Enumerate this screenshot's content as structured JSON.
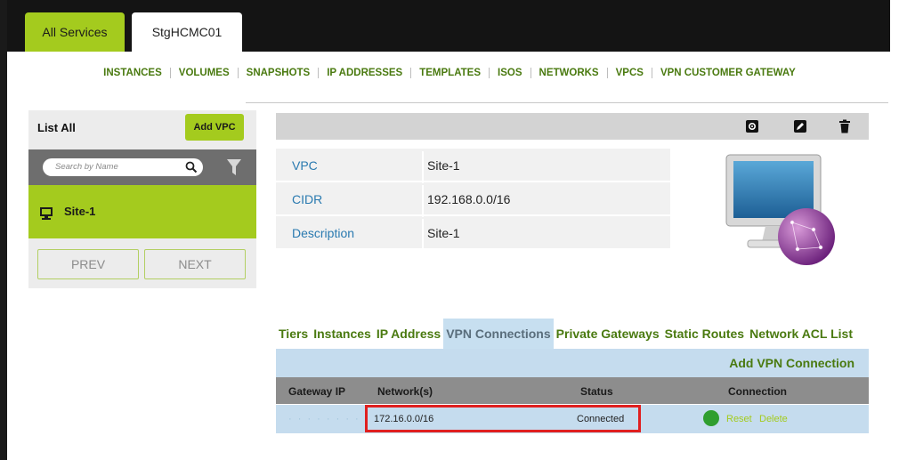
{
  "top_tabs": [
    {
      "label": "All Services"
    },
    {
      "label": "StgHCMC01"
    }
  ],
  "subnav": [
    "INSTANCES",
    "VOLUMES",
    "SNAPSHOTS",
    "IP ADDRESSES",
    "TEMPLATES",
    "ISOS",
    "NETWORKS",
    "VPCS",
    "VPN CUSTOMER GATEWAY"
  ],
  "left_panel": {
    "list_all": "List All",
    "add_vpc": "Add VPC",
    "search_placeholder": "Search by Name",
    "item": "Site-1",
    "prev": "PREV",
    "next": "NEXT"
  },
  "details": [
    {
      "key": "VPC",
      "value": "Site-1"
    },
    {
      "key": "CIDR",
      "value": "192.168.0.0/16"
    },
    {
      "key": "Description",
      "value": "Site-1"
    }
  ],
  "vpn_tabs": [
    "Tiers",
    "Instances",
    "IP Address",
    "VPN Connections",
    "Private Gateways",
    "Static Routes",
    "Network ACL List"
  ],
  "active_tab": "VPN Connections",
  "add_vpn_connection": "Add VPN Connection",
  "table": {
    "headers": {
      "gateway_ip": "Gateway IP",
      "networks": "Network(s)",
      "status": "Status",
      "connection": "Connection"
    },
    "row": {
      "gateway_ip": "· · · · · · · · ·",
      "networks": "172.16.0.0/16",
      "status": "Connected",
      "reset": "Reset",
      "delete": "Delete"
    }
  },
  "colors": {
    "accent": "#a4cb1e",
    "link": "#4a7a10",
    "highlight": "#e01f1f",
    "status_ok": "#2f9e2f"
  }
}
